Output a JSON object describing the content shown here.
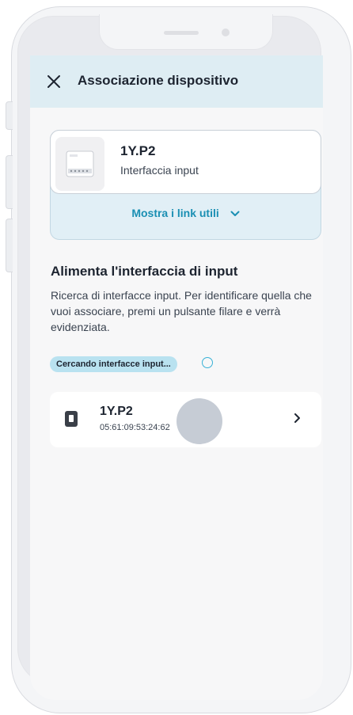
{
  "header": {
    "title": "Associazione dispositivo",
    "close_icon": "close-icon"
  },
  "device": {
    "name": "1Y.P2",
    "type": "Interfaccia input",
    "links_label": "Mostra i link utili",
    "links_icon": "chevron-down-icon"
  },
  "section": {
    "title": "Alimenta l'interfaccia di input",
    "description": "Ricerca di interfacce input. Per identificare quella che vuoi associare, premi un pulsante filare e verrà evidenziata."
  },
  "status": {
    "label": "Cercando interfacce input...",
    "icon": "spinner-icon"
  },
  "results": [
    {
      "name": "1Y.P2",
      "mac": "05:61:09:53:24:62",
      "icon": "input-interface-icon"
    }
  ],
  "colors": {
    "header_bg": "#deedf3",
    "accent": "#1a8fb3",
    "badge_bg": "#b9e2f0"
  }
}
